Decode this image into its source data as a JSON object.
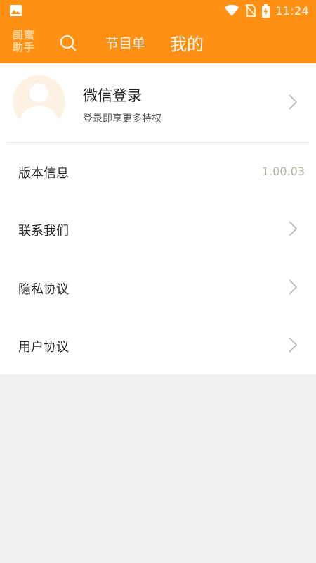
{
  "status_bar": {
    "time": "11:24",
    "icons": [
      "image-icon",
      "wifi-icon",
      "no-sim-icon",
      "battery-charging-icon"
    ]
  },
  "header": {
    "logo_line1": "闺蜜",
    "logo_line2": "助手",
    "tabs": [
      {
        "label": "节目单",
        "active": false
      },
      {
        "label": "我的",
        "active": true
      }
    ]
  },
  "profile": {
    "title": "微信登录",
    "subtitle": "登录即享更多特权"
  },
  "menu": {
    "version": {
      "label": "版本信息",
      "value": "1.00.03"
    },
    "contact": {
      "label": "联系我们"
    },
    "privacy": {
      "label": "隐私协议"
    },
    "user_agreement": {
      "label": "用户协议"
    }
  },
  "colors": {
    "accent": "#ff9014",
    "background": "#f2f0f0",
    "panel": "#ffffff",
    "version_text": "#b5b19c"
  }
}
